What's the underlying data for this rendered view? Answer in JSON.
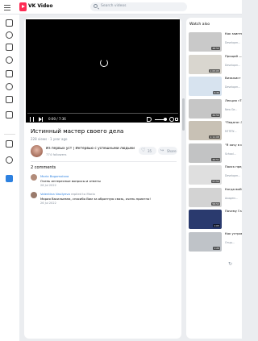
{
  "header": {
    "logo_text": "VK Video",
    "search_placeholder": "Search videos"
  },
  "player": {
    "time": "0:00 / 7:36"
  },
  "video": {
    "title": "Истинный мастер своего дела",
    "meta": "228 views · 1 year ago",
    "channel_name": "Из первых уст | Интервью с успешными людьми",
    "channel_subs": "774 followers",
    "likes": "35",
    "share_label": "Share"
  },
  "comments": {
    "count_label": "2 comments",
    "items": [
      {
        "name": "Maria Bogomolova",
        "reply": "",
        "text": "Очень интересные вопросы и ответы",
        "date": "26 Jul 2022",
        "avatar_color": "#b28c7a"
      },
      {
        "name": "Valentina Vasilyeva",
        "reply": "replied to Maria",
        "text": "Мария Васильевна, спасибо Вам за обратную связь, очень приятно!",
        "date": "26 Jul 2022",
        "avatar_color": "#9a7b6c"
      }
    ]
  },
  "sidebar": {
    "title": "Watch also",
    "items": [
      {
        "title": "Как заинтересовать детским...",
        "sub": "Developm...",
        "duration": "48:50",
        "color": "#c9c9c9"
      },
      {
        "title": "Прощай — взрослый...",
        "sub": "Developm...",
        "duration": "1:05:05",
        "color": "#d9d6cf"
      },
      {
        "title": "Визажист в рекламе...",
        "sub": "Developm...",
        "duration": "5:35",
        "color": "#d7e3ef"
      },
      {
        "title": "Лекция «Точка зрения...",
        "sub": "New Ge...",
        "duration": "49:59",
        "color": "#c6c6c6"
      },
      {
        "title": "\"Педагог-Эйнштейн...",
        "sub": "МГППУ...",
        "duration": "1:11:08",
        "color": "#c8c1b5"
      },
      {
        "title": "\"Я хочу в мир...",
        "sub": "School...",
        "duration": "40:51",
        "color": "#c2c3c4"
      },
      {
        "title": "Поиск предмета...",
        "sub": "Developm...",
        "duration": "57:54",
        "color": "#dfdfdf"
      },
      {
        "title": "Когда выбор армии...",
        "sub": "Академ...",
        "duration": "58:53",
        "color": "#d3d3d3"
      },
      {
        "title": "Почему Гасить презентацию...",
        "sub": "",
        "duration": "1:05",
        "color": "#2a3a6e"
      },
      {
        "title": "Как устроен... новорожд...",
        "sub": "Отцы...",
        "duration": "1:26",
        "color": "#bfc3c8"
      }
    ]
  }
}
